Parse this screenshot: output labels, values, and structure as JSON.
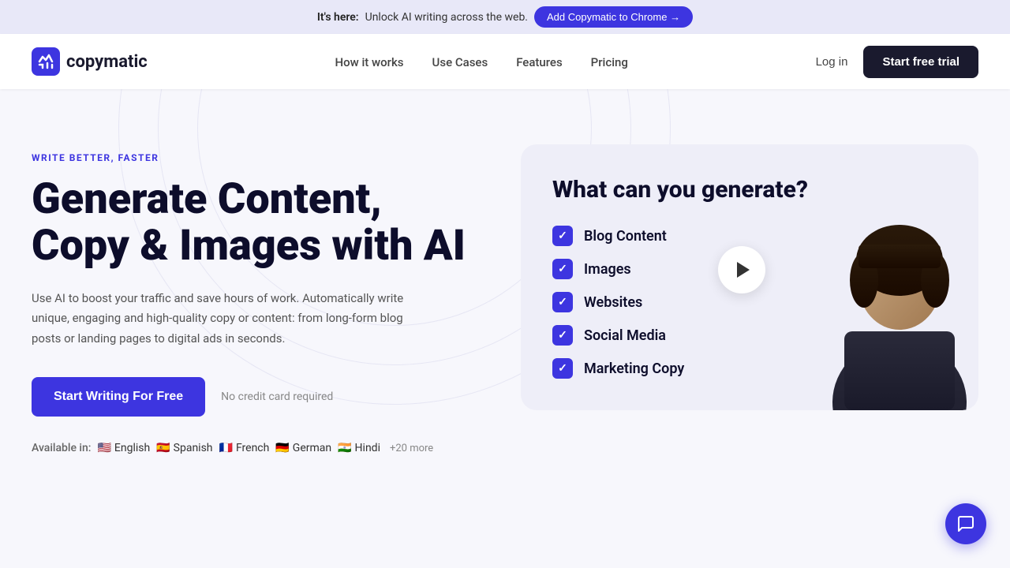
{
  "banner": {
    "pre_text": "It's here:",
    "text": " Unlock AI writing across the web.",
    "btn_label": "Add Copymatic to Chrome →"
  },
  "nav": {
    "logo_text": "copymatic",
    "links": [
      {
        "label": "How it works"
      },
      {
        "label": "Use Cases"
      },
      {
        "label": "Features"
      },
      {
        "label": "Pricing"
      }
    ],
    "login_label": "Log in",
    "trial_label": "Start free trial"
  },
  "hero": {
    "tagline": "WRITE BETTER, FASTER",
    "title_line1": "Generate Content,",
    "title_line2": "Copy & Images with AI",
    "description": "Use AI to boost your traffic and save hours of work. Automatically write unique, engaging and high-quality copy or content: from long-form blog posts or landing pages to digital ads in seconds.",
    "cta_label": "Start Writing For Free",
    "no_cc_text": "No credit card required",
    "available_label": "Available in:",
    "languages": [
      {
        "flag": "🇺🇸",
        "name": "English"
      },
      {
        "flag": "🇪🇸",
        "name": "Spanish"
      },
      {
        "flag": "🇫🇷",
        "name": "French"
      },
      {
        "flag": "🇩🇪",
        "name": "German"
      },
      {
        "flag": "🇮🇳",
        "name": "Hindi"
      }
    ],
    "more_langs": "+20 more"
  },
  "card": {
    "title": "What can you generate?",
    "items": [
      "Blog Content",
      "Images",
      "Websites",
      "Social Media",
      "Marketing Copy"
    ]
  },
  "chat_icon": "💬"
}
